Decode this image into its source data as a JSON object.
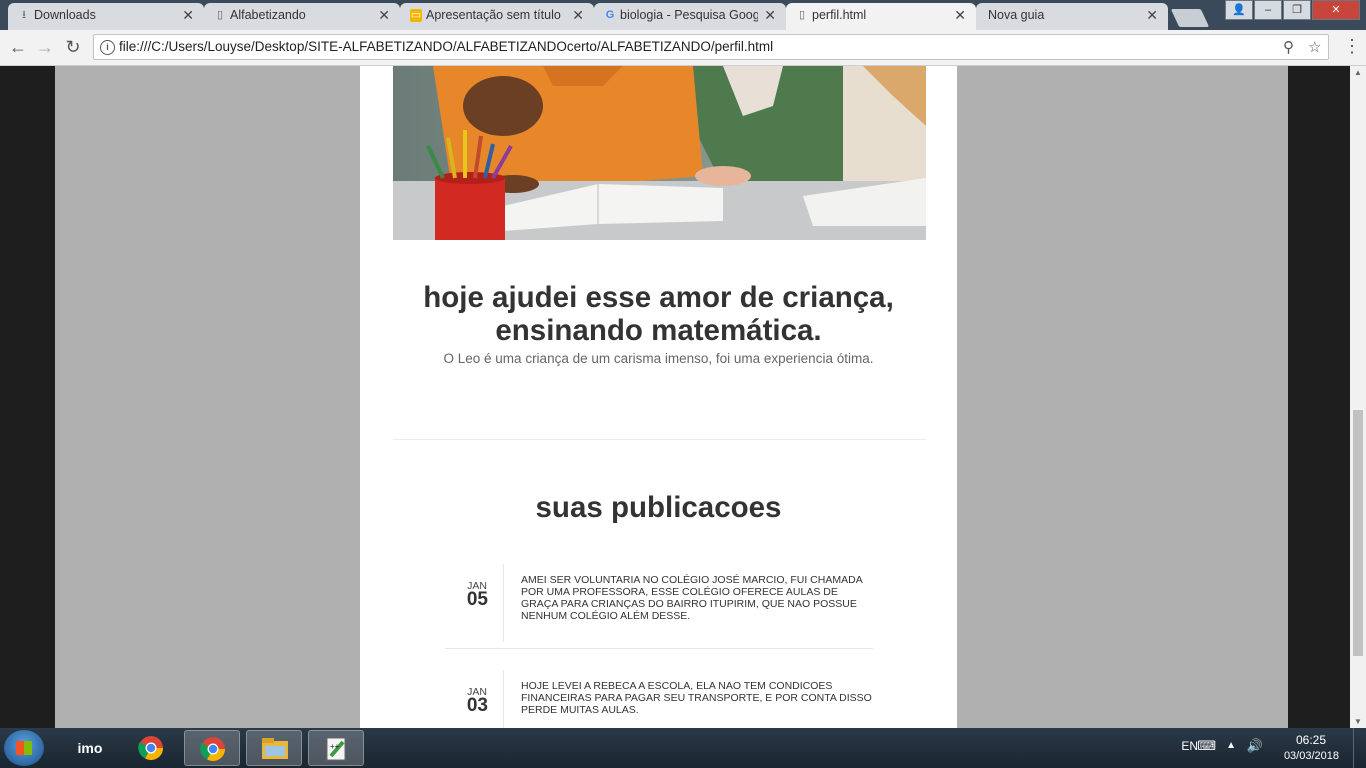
{
  "browser": {
    "tabs": [
      {
        "label": "Downloads",
        "icon": "download-icon"
      },
      {
        "label": "Alfabetizando",
        "icon": "document-icon"
      },
      {
        "label": "Apresentação sem título",
        "icon": "slides-icon"
      },
      {
        "label": "biologia - Pesquisa Goog",
        "icon": "google-icon"
      },
      {
        "label": "perfil.html",
        "icon": "document-icon",
        "active": true
      },
      {
        "label": "Nova guia",
        "icon": ""
      }
    ],
    "url": "file:///C:/Users/Louyse/Desktop/SITE-ALFABETIZANDO/ALFABETIZANDOcerto/ALFABETIZANDO/perfil.html"
  },
  "page": {
    "post_title": "hoje ajudei esse amor de criança, ensinando matemática.",
    "post_description": "O Leo é uma criança de um carisma imenso, foi uma experiencia ótima.",
    "publications_heading": "suas publicacoes",
    "publications": [
      {
        "month": "JAN",
        "day": "05",
        "text": "AMEI SER VOLUNTARIA NO COLÉGIO JOSÉ MARCIO, FUI CHAMADA POR UMA PROFESSORA, ESSE COLÉGIO OFERECE AULAS DE GRAÇA PARA CRIANÇAS DO BAIRRO ITUPIRIM, QUE NAO POSSUE NENHUM COLÉGIO ALÉM DESSE."
      },
      {
        "month": "JAN",
        "day": "03",
        "text": "HOJE LEVEI A REBECA A ESCOLA, ELA NAO TEM CONDICOES FINANCEIRAS PARA PAGAR SEU TRANSPORTE, E POR CONTA DISSO PERDE MUITAS AULAS."
      }
    ]
  },
  "taskbar": {
    "apps": [
      "imo-icon",
      "chrome-icon",
      "chrome-icon",
      "file-explorer-icon",
      "notepad-plus-plus-icon"
    ],
    "language": "EN",
    "time": "06:25",
    "date": "03/03/2018"
  }
}
